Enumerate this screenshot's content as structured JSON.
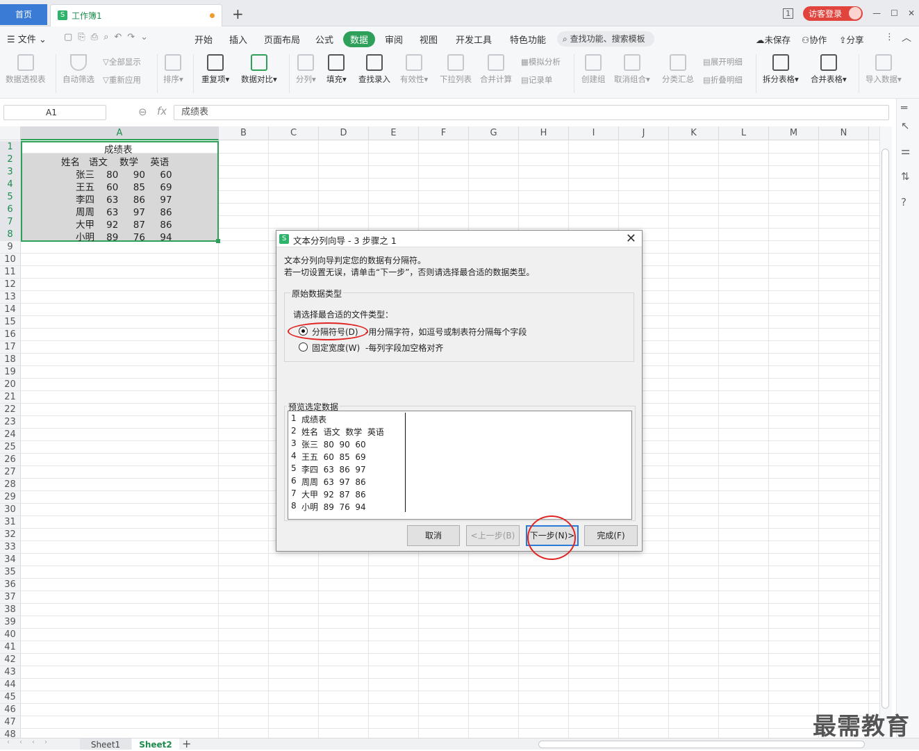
{
  "titlebar": {
    "home_tab": "首页",
    "workbook_tab": "工作簿1",
    "workbook_icon": "S",
    "new_tab": "+",
    "login_button": "访客登录",
    "window_controls": [
      "—",
      "☐",
      "✕"
    ]
  },
  "menubar": {
    "file": "文件",
    "tabs": [
      "开始",
      "插入",
      "页面布局",
      "公式",
      "数据",
      "审阅",
      "视图",
      "开发工具",
      "特色功能"
    ],
    "active_tab": "数据",
    "search": "查找功能、搜索模板",
    "unsaved": "未保存",
    "collaborate": "协作",
    "share": "分享"
  },
  "ribbon": {
    "pivot": "数据透视表",
    "auto_filter": "自动筛选",
    "show_all": "全部显示",
    "reapply": "重新应用",
    "sort": "排序",
    "duplicates": "重复项",
    "compare": "数据对比",
    "split_column": "分列",
    "fill": "填充",
    "lookup": "查找录入",
    "validity": "有效性",
    "dropdown": "下拉列表",
    "consolidate": "合并计算",
    "simulate": "模拟分析",
    "record": "记录单",
    "group": "创建组",
    "ungroup": "取消组合",
    "subtotal": "分类汇总",
    "expand": "展开明细",
    "collapse": "折叠明细",
    "split_table": "拆分表格",
    "merge_table": "合并表格",
    "import": "导入数据"
  },
  "formula_bar": {
    "cell_ref": "A1",
    "fx": "fx",
    "content": "成绩表"
  },
  "sheet": {
    "columns": [
      "A",
      "B",
      "C",
      "D",
      "E",
      "F",
      "G",
      "H",
      "I",
      "J",
      "K",
      "L",
      "M",
      "N"
    ],
    "rows": [
      "1",
      "2",
      "3",
      "4",
      "5",
      "6",
      "7",
      "8",
      "9",
      "10",
      "11",
      "12",
      "13",
      "14",
      "15",
      "16",
      "17",
      "18",
      "19",
      "20",
      "21",
      "22",
      "23",
      "24",
      "25",
      "26",
      "27",
      "28",
      "29",
      "30",
      "31",
      "32",
      "33",
      "34",
      "35",
      "36",
      "37",
      "38",
      "39",
      "40",
      "41",
      "42",
      "43",
      "44",
      "45",
      "46",
      "47",
      "48"
    ],
    "cells": [
      "成绩表",
      "姓名   语文    数学    英语",
      "张三    80     90     60",
      "王五    60     85     69",
      "李四    63     86     97",
      "周周    63     97     86",
      "大甲    92     87     86",
      "小明    89     76     94"
    ]
  },
  "sheet_tabs": {
    "sheet1": "Sheet1",
    "sheet2": "Sheet2",
    "add": "+"
  },
  "dialog": {
    "icon": "S",
    "title": "文本分列向导 - 3 步骤之 1",
    "close": "✕",
    "intro1": "文本分列向导判定您的数据有分隔符。",
    "intro2": "若一切设置无误，请单击“下一步”，否则请选择最合适的数据类型。",
    "group_title": "原始数据类型",
    "prompt": "请选择最合适的文件类型：",
    "opt_delimited": "分隔符号(D)",
    "opt_delimited_desc": "-用分隔字符，如逗号或制表符分隔每个字段",
    "opt_fixed": "固定宽度(W)",
    "opt_fixed_desc": "-每列字段加空格对齐",
    "preview_title": "预览选定数据",
    "preview_rows": [
      {
        "n": "1",
        "t": "成绩表"
      },
      {
        "n": "2",
        "t": "姓名  语文  数学  英语"
      },
      {
        "n": "3",
        "t": "张三  80  90  60"
      },
      {
        "n": "4",
        "t": "王五  60  85  69"
      },
      {
        "n": "5",
        "t": "李四  63  86  97"
      },
      {
        "n": "6",
        "t": "周周  63  97  86"
      },
      {
        "n": "7",
        "t": "大甲  92  87  86"
      },
      {
        "n": "8",
        "t": "小明  89  76  94"
      }
    ],
    "btn_cancel": "取消",
    "btn_prev": "<上一步(B)",
    "btn_next": "下一步(N)>",
    "btn_finish": "完成(F)"
  },
  "watermark": "最需教育",
  "colors": {
    "accent_green": "#2fa05a",
    "home_tab_blue": "#3a7bd5",
    "annotation_red": "#e02424",
    "selection_fill": "#d8d8d8"
  }
}
